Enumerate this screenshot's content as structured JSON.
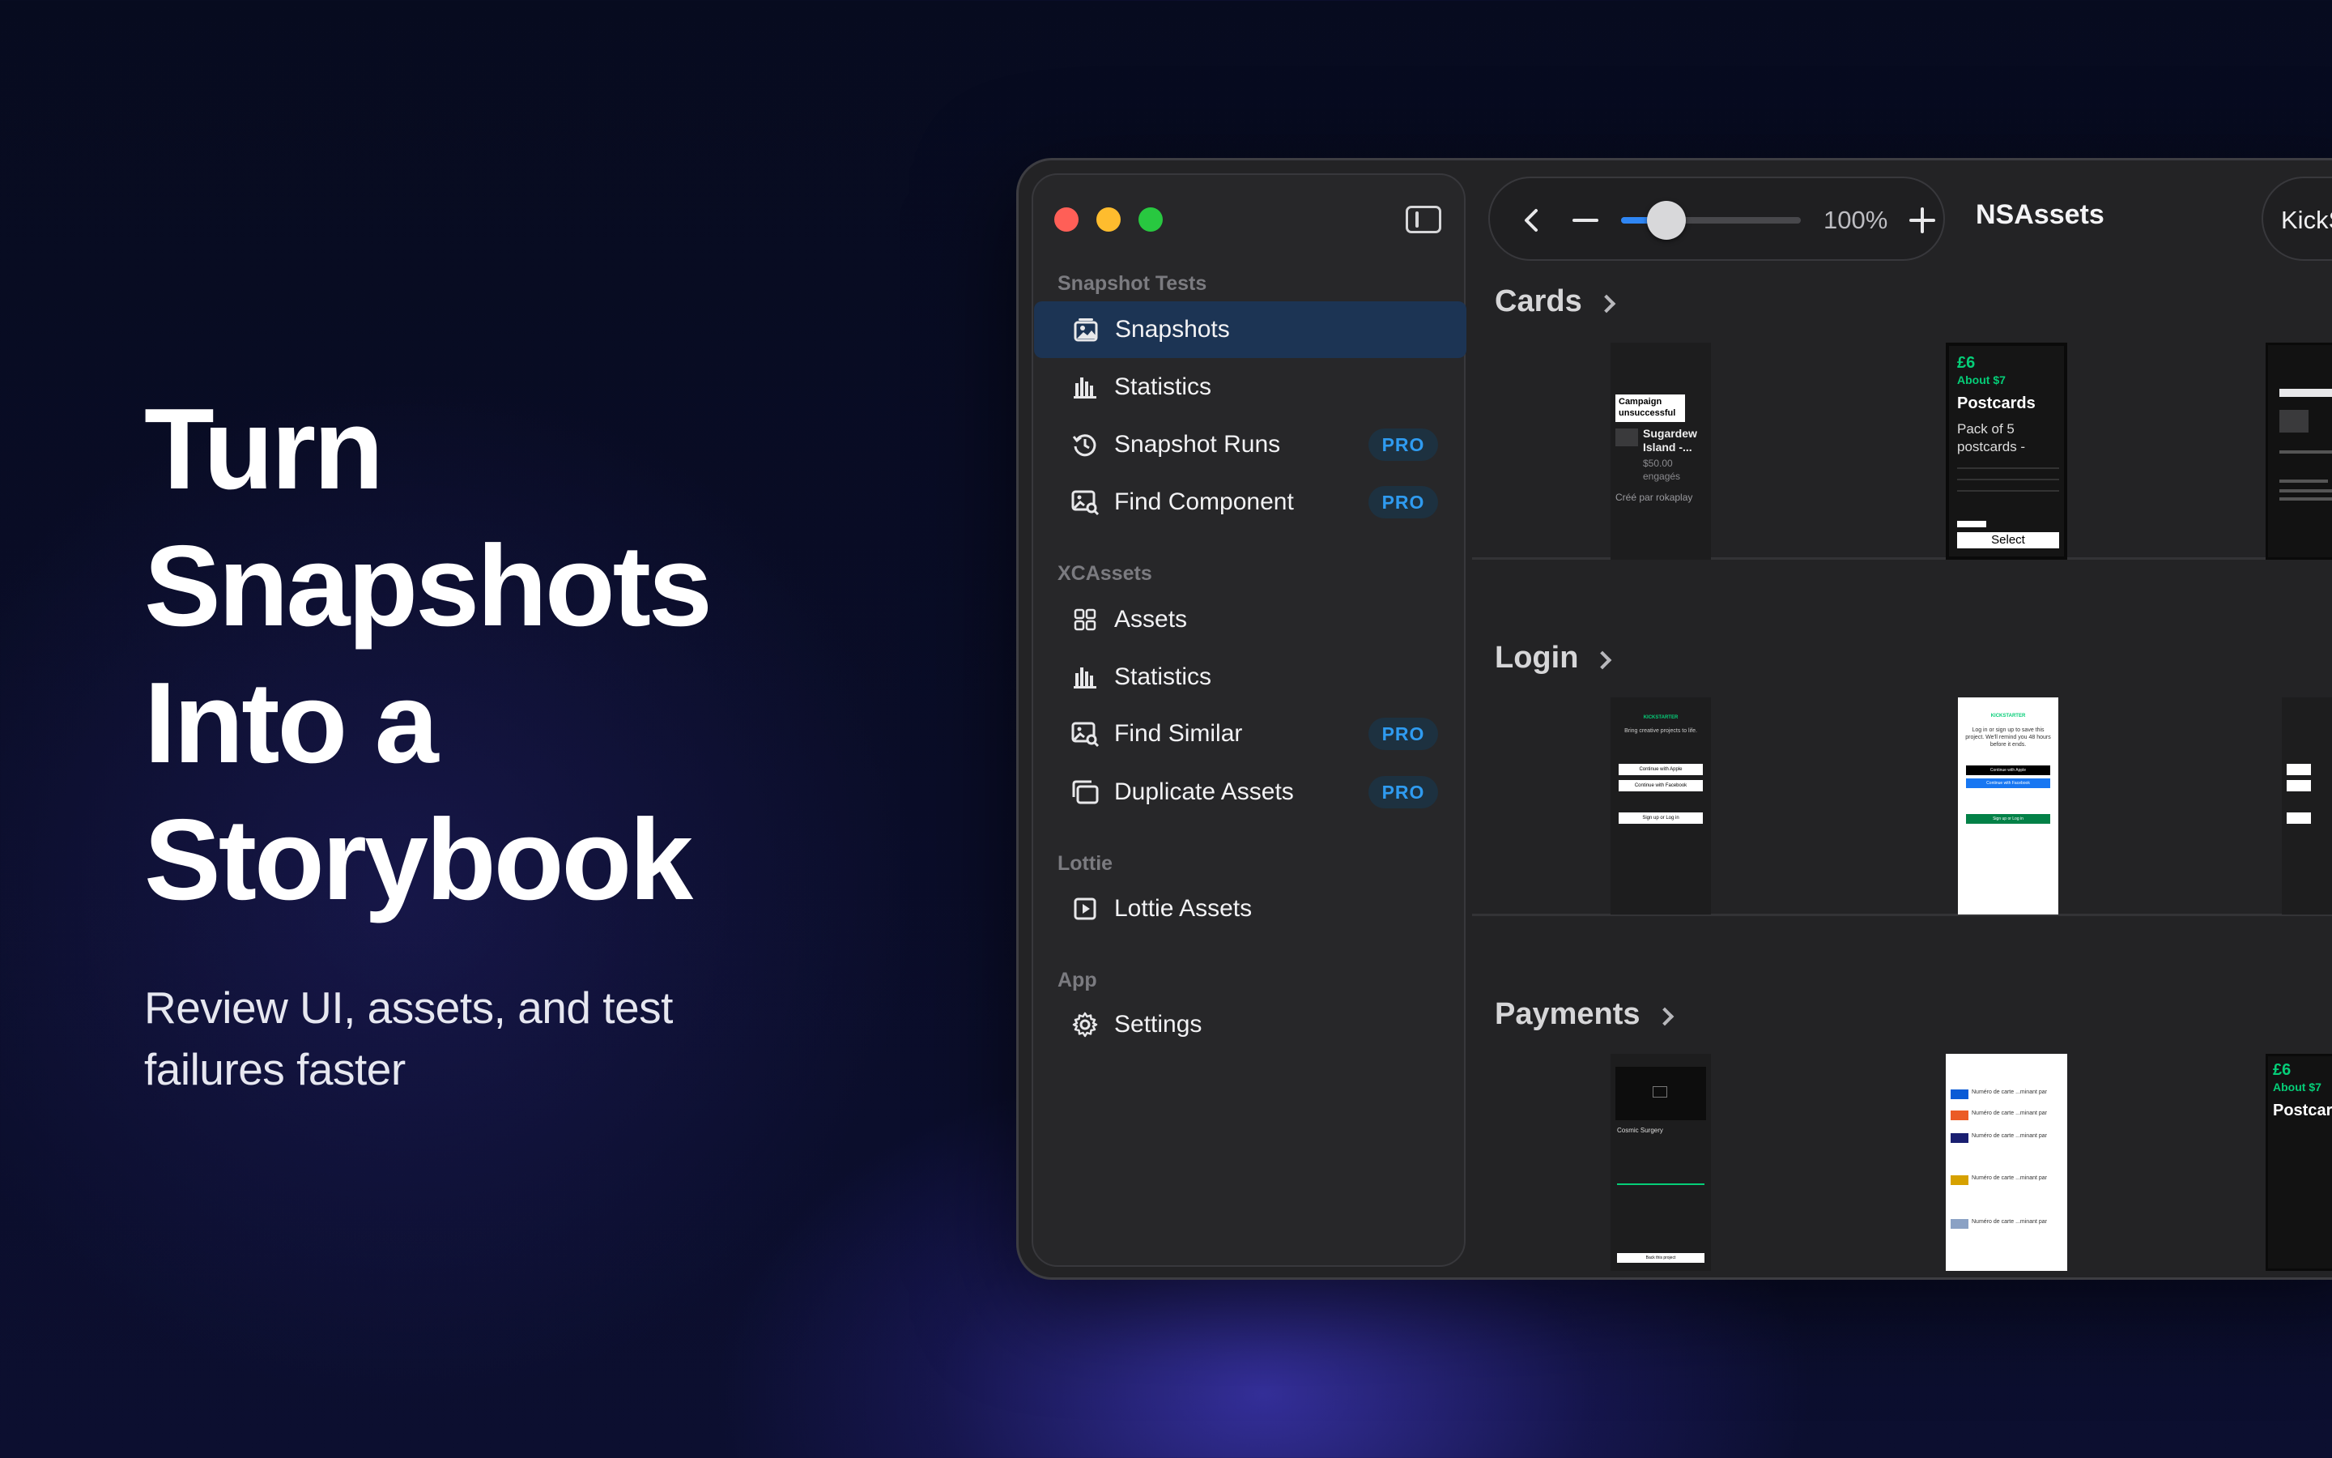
{
  "hero": {
    "title_lines": [
      "Turn",
      "Snapshots",
      "Into a",
      "Storybook"
    ],
    "subtitle": "Review UI, assets, and test failures faster"
  },
  "sidebar": {
    "sections": [
      {
        "label": "Snapshot Tests"
      },
      {
        "label": "XCAssets"
      },
      {
        "label": "Lottie"
      },
      {
        "label": "App"
      }
    ],
    "items": [
      {
        "label": "Snapshots",
        "icon": "snapshots-icon",
        "active": true
      },
      {
        "label": "Statistics",
        "icon": "bar-chart-icon"
      },
      {
        "label": "Snapshot Runs",
        "icon": "history-icon",
        "badge": "PRO"
      },
      {
        "label": "Find Component",
        "icon": "image-search-icon",
        "badge": "PRO"
      },
      {
        "label": "Assets",
        "icon": "grid-icon"
      },
      {
        "label": "Statistics",
        "icon": "bar-chart-icon"
      },
      {
        "label": "Find Similar",
        "icon": "image-search-icon",
        "badge": "PRO"
      },
      {
        "label": "Duplicate Assets",
        "icon": "duplicate-icon",
        "badge": "PRO"
      },
      {
        "label": "Lottie Assets",
        "icon": "play-square-icon"
      },
      {
        "label": "Settings",
        "icon": "gear-icon"
      }
    ]
  },
  "toolbar": {
    "zoom": "100%",
    "zoom_level": 0.25,
    "title": "NSAssets",
    "chip": "KickS"
  },
  "content": {
    "sections": [
      {
        "title": "Cards"
      },
      {
        "title": "Login"
      },
      {
        "title": "Payments"
      }
    ],
    "cards": {
      "thumb1": {
        "badge": "Campaign unsuccessful",
        "name": "Sugardew Island -...",
        "price": "$50.00",
        "status": "engagés",
        "creator": "Créé par rokaplay"
      },
      "thumb2": {
        "price": "£6",
        "about": "About $7",
        "title": "Postcards",
        "desc": "Pack of 5 postcards -",
        "button": "Select"
      }
    },
    "login": {
      "brand": "KICKSTARTER",
      "tagline": "Bring creative projects to life.",
      "apple": "Continue with Apple",
      "facebook": "Continue with Facebook",
      "signup": "Sign up or Log in",
      "tagline2": "Log in or sign up to save this project. We'll remind you 48 hours before it ends."
    },
    "payments": {
      "project": "Cosmic Surgery",
      "back_button": "Back this project",
      "card_label": "Numéro de carte ...minant par"
    }
  },
  "colors": {
    "accent": "#2f86f4",
    "pro_text": "#2f9bf0",
    "active_item": "#1c3454",
    "kickstarter_green": "#05ce78"
  }
}
